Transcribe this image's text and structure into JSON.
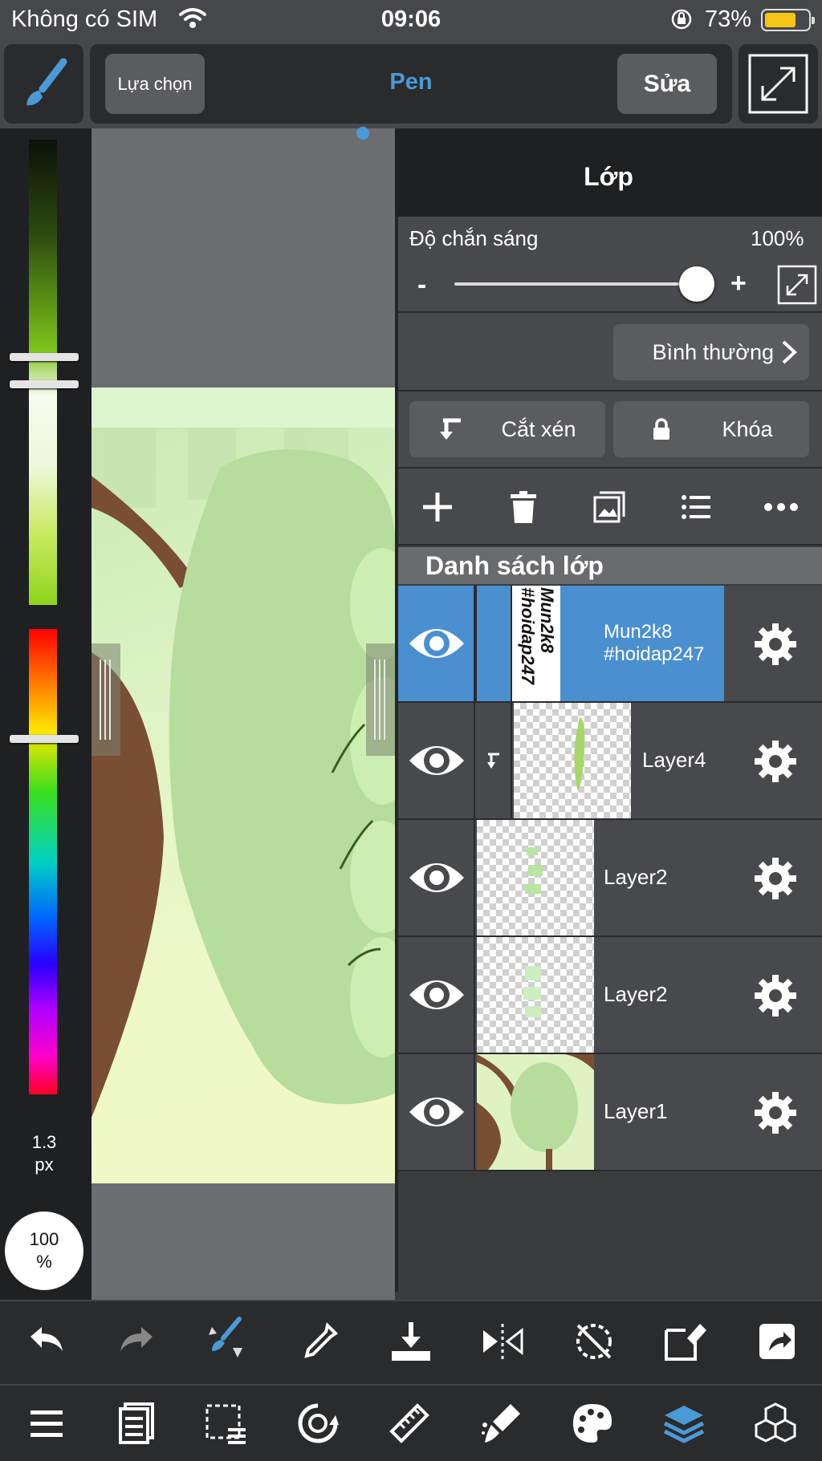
{
  "status_bar": {
    "carrier": "Không có SIM",
    "time": "09:06",
    "battery": "73%",
    "battery_level": 0.73
  },
  "toolbar": {
    "select_label": "Lựa chọn",
    "tool_name": "Pen",
    "edit_label": "Sửa"
  },
  "color_panel": {
    "brush_size": "1.3",
    "brush_size_unit": "px",
    "opacity": "100",
    "opacity_unit": "%"
  },
  "layer_panel": {
    "title": "Lớp",
    "opacity_label": "Độ chắn sáng",
    "opacity_value": "100%",
    "opacity_level": 1.0,
    "minus": "-",
    "plus": "+",
    "blend_mode": "Bình thường",
    "clip_label": "Cắt xén",
    "lock_label": "Khóa",
    "list_header": "Danh sách lớp",
    "layers": [
      {
        "name": "Mun2k8\n#hoidap247",
        "name_line1": "Mun2k8",
        "name_line2": "#hoidap247",
        "selected": true,
        "clipped": false
      },
      {
        "name": "Layer4",
        "selected": false,
        "clipped": true
      },
      {
        "name": "Layer2",
        "selected": false,
        "clipped": false
      },
      {
        "name": "Layer2",
        "selected": false,
        "clipped": false
      },
      {
        "name": "Layer1",
        "selected": false,
        "clipped": false
      }
    ]
  },
  "thumb_text": {
    "line1": "Mun2k8",
    "line2": "#hoidap247"
  },
  "colors": {
    "accent": "#4a9ad6",
    "selected_layer": "#4a8fd0",
    "panel_bg": "#48494c",
    "toolbar_bg": "#2a2b2d"
  },
  "bottom_toolbar": {
    "row1_icons": [
      "undo-icon",
      "redo-icon",
      "brush-swap-icon",
      "eyedropper-icon",
      "save-icon",
      "flip-icon",
      "rotate-off-icon",
      "transform-icon",
      "share-icon"
    ],
    "row2_icons": [
      "menu-icon",
      "pages-icon",
      "selection-icon",
      "rotate-canvas-icon",
      "ruler-icon",
      "fill-icon",
      "palette-icon",
      "layers-icon",
      "materials-icon"
    ]
  }
}
